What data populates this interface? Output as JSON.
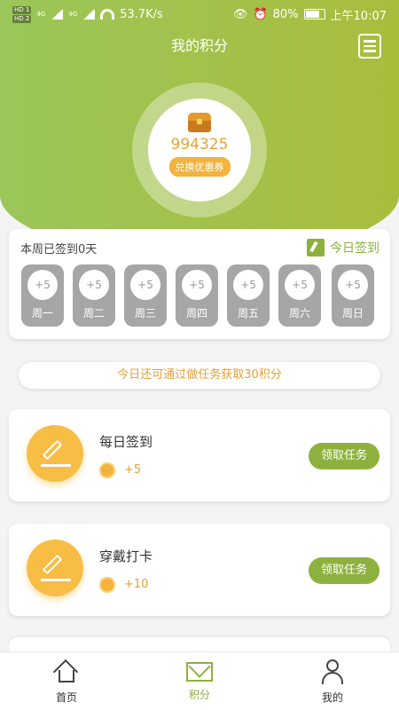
{
  "status_bar": {
    "network_speed": "53.7K/s",
    "signal_labels": [
      "HD 1",
      "HD 2"
    ],
    "network_types": [
      "4G",
      "4G"
    ],
    "battery": "80%",
    "time": "上午10:07"
  },
  "header": {
    "title": "我的积分",
    "menu_icon": "menu-icon"
  },
  "points": {
    "value": "994325",
    "exchange_label": "兑换优惠券",
    "icon": "treasure-chest-icon"
  },
  "signin": {
    "week_text": "本周已签到0天",
    "today_label": "今日签到",
    "days": [
      {
        "reward": "+5",
        "name": "周一"
      },
      {
        "reward": "+5",
        "name": "周二"
      },
      {
        "reward": "+5",
        "name": "周三"
      },
      {
        "reward": "+5",
        "name": "周四"
      },
      {
        "reward": "+5",
        "name": "周五"
      },
      {
        "reward": "+5",
        "name": "周六"
      },
      {
        "reward": "+5",
        "name": "周日"
      }
    ]
  },
  "tip": "今日还可通过做任务获取30积分",
  "tasks": [
    {
      "title": "每日签到",
      "reward": "+5",
      "button": "领取任务"
    },
    {
      "title": "穿戴打卡",
      "reward": "+10",
      "button": "领取任务"
    }
  ],
  "tabbar": {
    "items": [
      {
        "label": "首页",
        "icon": "home-icon"
      },
      {
        "label": "积分",
        "icon": "mail-icon"
      },
      {
        "label": "我的",
        "icon": "user-icon"
      }
    ],
    "active_index": 1
  },
  "colors": {
    "brand_green": "#8db13e",
    "accent_orange": "#f3b33d",
    "day_gray": "#a6a6a6"
  }
}
